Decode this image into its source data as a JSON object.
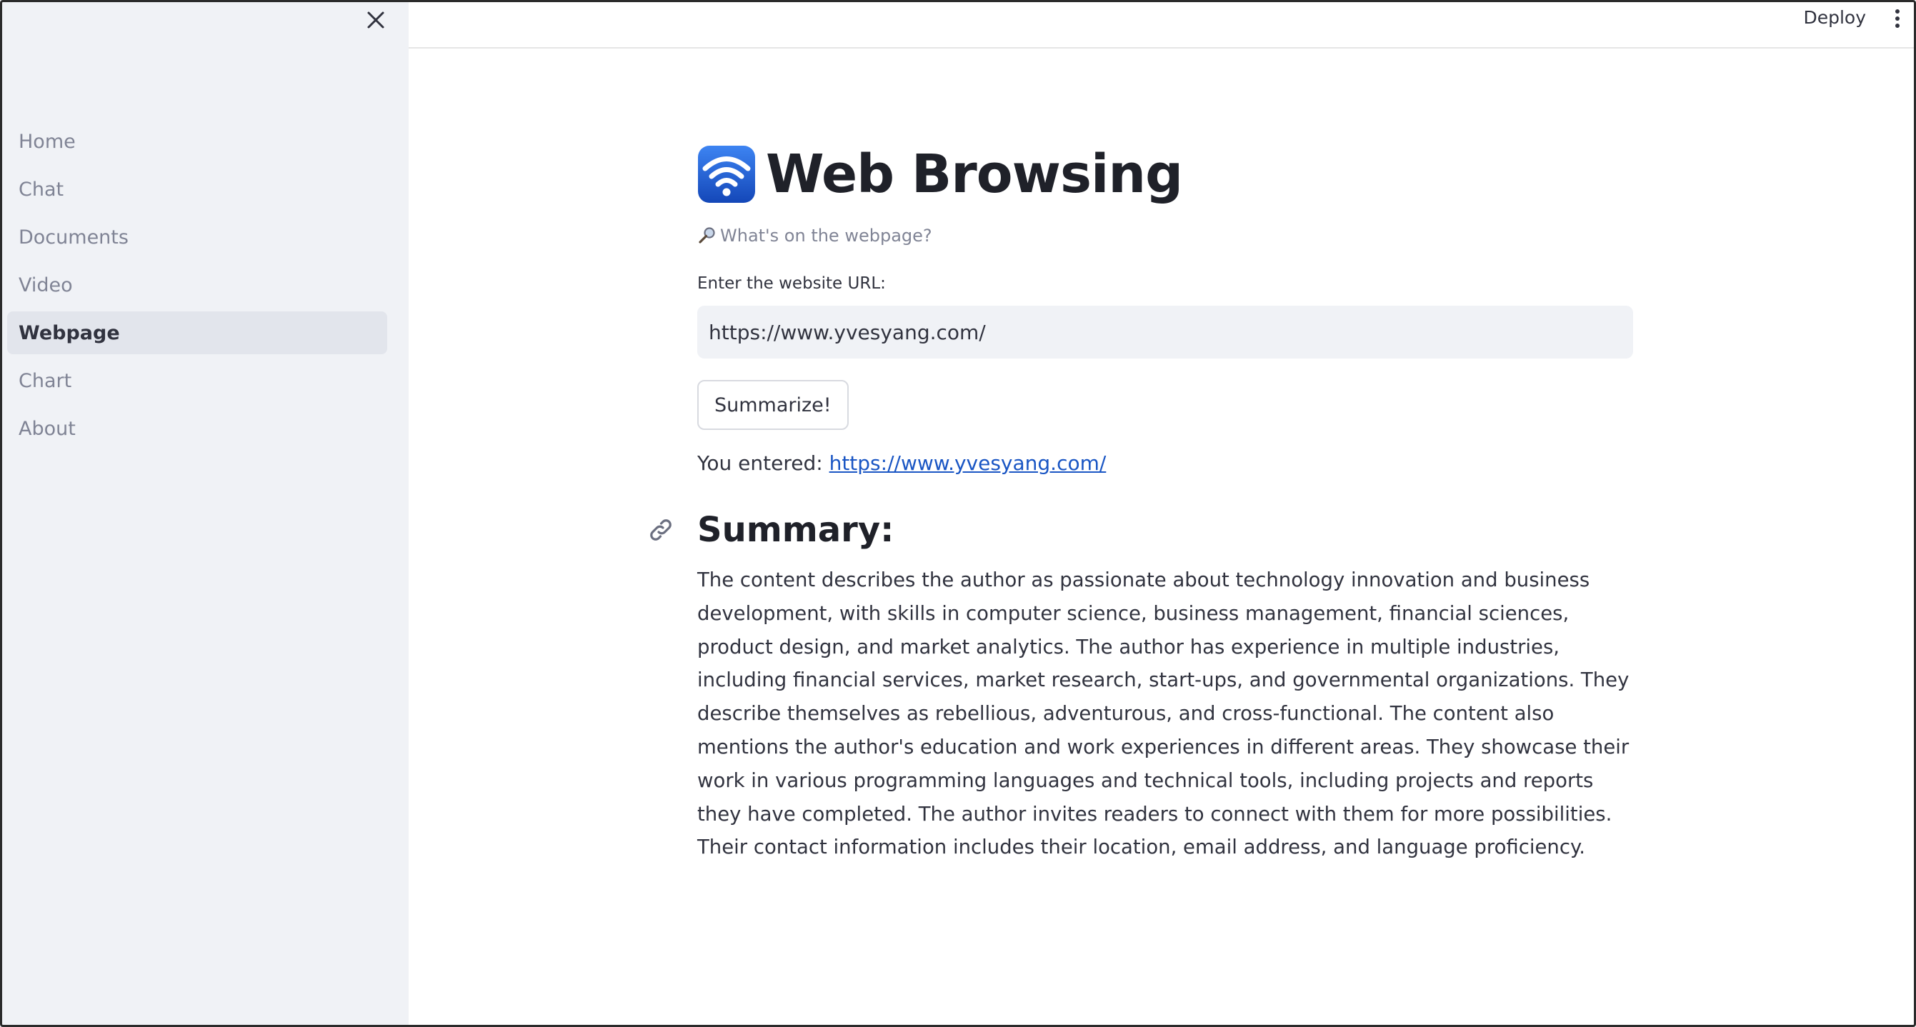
{
  "sidebar": {
    "close_icon": "close-icon",
    "items": [
      {
        "label": "Home",
        "active": false
      },
      {
        "label": "Chat",
        "active": false
      },
      {
        "label": "Documents",
        "active": false
      },
      {
        "label": "Video",
        "active": false
      },
      {
        "label": "Webpage",
        "active": true
      },
      {
        "label": "Chart",
        "active": false
      },
      {
        "label": "About",
        "active": false
      }
    ]
  },
  "header": {
    "deploy_label": "Deploy",
    "menu_icon": "kebab-menu-icon"
  },
  "main": {
    "title": "Web Browsing",
    "title_icon": "wifi-icon",
    "subtitle": "What's on the webpage?",
    "subtitle_icon": "magnifier-icon",
    "input_label": "Enter the website URL:",
    "url_value": "https://www.yvesyang.com/",
    "button_label": "Summarize!",
    "entered_prefix": "You entered: ",
    "entered_url": "https://www.yvesyang.com/",
    "summary_heading": "Summary:",
    "summary_text": "The content describes the author as passionate about technology innovation and business development, with skills in computer science, business management, financial sciences, product design, and market analytics. The author has experience in multiple industries, including financial services, market research, start-ups, and governmental organizations. They describe themselves as rebellious, adventurous, and cross-functional. The content also mentions the author's education and work experiences in different areas. They showcase their work in various programming languages and technical tools, including projects and reports they have completed. The author invites readers to connect with them for more possibilities. Their contact information includes their location, email address, and language proficiency."
  },
  "colors": {
    "sidebar_bg": "#f0f2f6",
    "active_item_bg": "#e2e5ec",
    "link": "#1a56c4",
    "wifi_icon_bg": "#1d5fd6",
    "text": "#31333f"
  }
}
